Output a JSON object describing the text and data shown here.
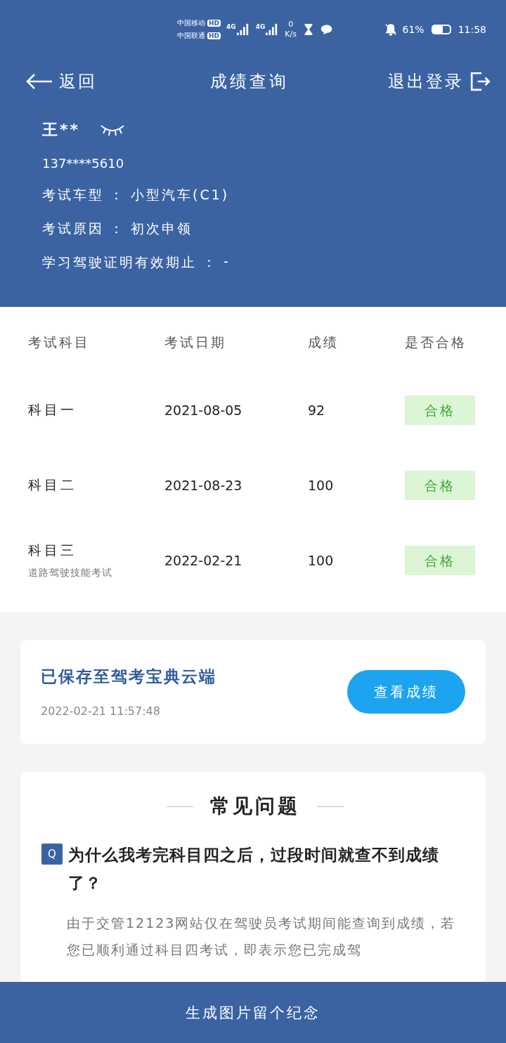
{
  "status_bar": {
    "carriers": [
      {
        "name": "中国移动",
        "badge": "HD",
        "network": "4G"
      },
      {
        "name": "中国联通",
        "badge": "HD",
        "network": "4G"
      }
    ],
    "speed_value": "0",
    "speed_unit": "K/s",
    "battery_text": "61%",
    "battery": {
      "level": 0.61
    },
    "time": "11:58"
  },
  "header": {
    "back_label": "返回",
    "title": "成绩查询",
    "logout_label": "退出登录"
  },
  "profile": {
    "name": "王**",
    "phone": "137****5610",
    "fields": [
      {
        "label": "考试车型",
        "separator": "：",
        "value": "小型汽车(C1)"
      },
      {
        "label": "考试原因",
        "separator": "：",
        "value": "初次申领"
      },
      {
        "label": "学习驾驶证明有效期止",
        "separator": "：",
        "value": "-"
      }
    ]
  },
  "table": {
    "columns": [
      "考试科目",
      "考试日期",
      "成绩",
      "是否合格"
    ],
    "rows": [
      {
        "subject": "科目一",
        "note": null,
        "date": "2021-08-05",
        "score": "92",
        "result": "合格",
        "passed": true
      },
      {
        "subject": "科目二",
        "note": null,
        "date": "2021-08-23",
        "score": "100",
        "result": "合格",
        "passed": true
      },
      {
        "subject": "科目三",
        "note": "道路驾驶技能考试",
        "date": "2022-02-21",
        "score": "100",
        "result": "合格",
        "passed": true
      }
    ]
  },
  "cloud": {
    "title": "已保存至驾考宝典云端",
    "time": "2022-02-21 11:57:48",
    "button": "查看成绩"
  },
  "faq": {
    "title": "常见问题",
    "items": [
      {
        "badge": "Q",
        "question": "为什么我考完科目四之后，过段时间就查不到成绩了？",
        "answer": "由于交管12123网站仅在驾驶员考试期间能查询到成绩，若您已顺利通过科目四考试，即表示您已完成驾"
      }
    ]
  },
  "bottom_button": "生成图片留个纪念"
}
